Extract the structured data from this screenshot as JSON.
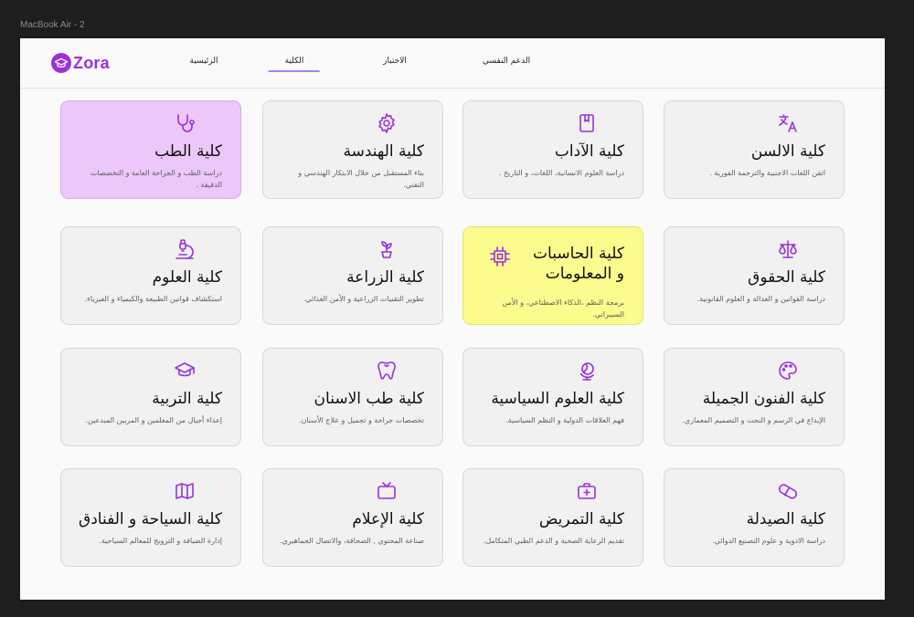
{
  "frame": {
    "label": "MacBook Air - 2"
  },
  "brand": {
    "name": "Zora",
    "color": "#9b30d9"
  },
  "nav": {
    "home": "الرئيسية",
    "college": "الكلية",
    "test": "الاختبار",
    "support": "الدعم النفسي",
    "active": "college"
  },
  "colors": {
    "highlight_pink": "#ecc7fa",
    "highlight_yellow": "#fbfb8e",
    "icon": "#9b30d9"
  },
  "cards": {
    "medicine": {
      "title": "كلية الطب",
      "desc": "دراسة الطب و الجراحة العامة و التخصصات الدقيقة .",
      "icon": "stethoscope-icon",
      "highlight": "pink"
    },
    "engineering": {
      "title": "كلية الهندسة",
      "desc": "بناء المستقبل من خلال الابتكار الهندسي و التقني.",
      "icon": "gear-icon"
    },
    "arts": {
      "title": "كلية الآداب",
      "desc": "دراسة العلوم الانسانية، اللغات، و التاريخ .",
      "icon": "book-icon"
    },
    "languages": {
      "title": "كلية الالسن",
      "desc": "اتقن اللغات الاجنبية والترجمة الفورية .",
      "icon": "translate-icon"
    },
    "science": {
      "title": "كلية العلوم",
      "desc": "استكشاف قوانين الطبيعة والكيمياء و الفيزياء.",
      "icon": "microscope-icon"
    },
    "agriculture": {
      "title": "كلية الزراعة",
      "desc": "تطوير التقنيات الزراعية و الأمن الغذائي.",
      "icon": "plant-icon"
    },
    "computers": {
      "title": "كلية الحاسبات و المعلومات",
      "desc": "برمجة النظم ،الذكاء الاصطناعي، و الأمن السيبراني.",
      "icon": "cpu-icon",
      "highlight": "yellow"
    },
    "law": {
      "title": "كلية الحقوق",
      "desc": "دراسة القوانين و العدالة و العلوم القانونية.",
      "icon": "scales-icon"
    },
    "education": {
      "title": "كلية التربية",
      "desc": "إعداء أجيال من المعلمين و المربين المبدعين.",
      "icon": "graduation-cap-icon"
    },
    "dentistry": {
      "title": "كلية طب الاسنان",
      "desc": "تخصصات جراحة و تجميل و علاج الأسنان.",
      "icon": "tooth-icon"
    },
    "political": {
      "title": "كلية العلوم السياسية",
      "desc": "فهم العلاقات الدولية و النظم السياسية.",
      "icon": "globe-icon"
    },
    "finearts": {
      "title": "كلية الفنون الجميلة",
      "desc": "الإبداع في الرسم و النحت و التصميم المعماري.",
      "icon": "palette-icon"
    },
    "tourism": {
      "title": "كلية السياحة و الفنادق",
      "desc": "إدارة الضيافة و الترويج للمعالم السياحية.",
      "icon": "map-icon"
    },
    "media": {
      "title": "كلية الإعلام",
      "desc": "صناعة المحتوي , الصحافة، والاتصال الجماهيري.",
      "icon": "tv-icon"
    },
    "nursing": {
      "title": "كلية التمريض",
      "desc": "تقديم الرعاية الصحية و الدعم الطبي المتكامل.",
      "icon": "first-aid-kit-icon"
    },
    "pharmacy": {
      "title": "كلية الصيدلة",
      "desc": "دراسة الادوية و علوم التصنيع الدوائي.",
      "icon": "pill-icon"
    }
  }
}
